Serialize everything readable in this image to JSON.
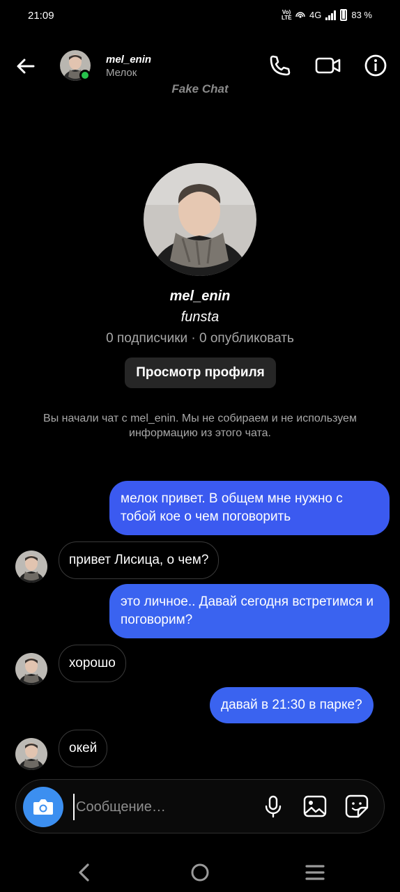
{
  "status": {
    "time": "21:09",
    "volte": "Vo) LTE",
    "network": "4G",
    "battery": "83 %"
  },
  "header": {
    "username": "mel_enin",
    "subtitle": "Мелок",
    "watermark": "Fake Chat",
    "icons": [
      "back-arrow-icon",
      "phone-icon",
      "video-icon",
      "info-icon"
    ],
    "online_color": "#27c24c"
  },
  "profile": {
    "username": "mel_enin",
    "subtitle": "funsta",
    "stats": "0 подписчики · 0 опубликовать",
    "view_button": "Просмотр профиля",
    "note": "Вы начали чат с mel_enin. Мы не собираем и не используем информацию из этого чата."
  },
  "messages": [
    {
      "from": "me",
      "text": "мелок привет.  В общем мне нужно с тобой кое о чем поговорить"
    },
    {
      "from": "them",
      "text": "привет Лисица, о чем?"
    },
    {
      "from": "me",
      "text": "это личное.. Давай сегодня встретимся и поговорим?"
    },
    {
      "from": "them",
      "text": "хорошо"
    },
    {
      "from": "me",
      "text": "давай в 21:30 в парке?"
    },
    {
      "from": "them",
      "text": "окей"
    }
  ],
  "composer": {
    "placeholder": "Сообщение…",
    "icons": [
      "camera-icon",
      "microphone-icon",
      "gallery-icon",
      "sticker-icon"
    ],
    "camera_color": "#3c8ff0"
  },
  "navbar": {
    "icons": [
      "nav-back-icon",
      "nav-home-icon",
      "nav-recents-icon"
    ]
  },
  "colors": {
    "outgoing_bubble": "#3b5af0",
    "background": "#000000"
  }
}
